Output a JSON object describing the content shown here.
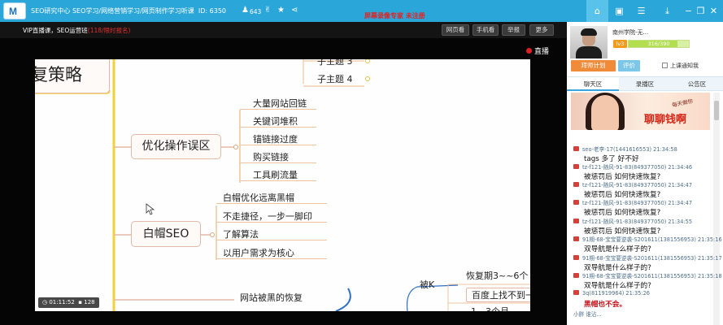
{
  "titlebar": {
    "logo": "M",
    "title": "SEO研究中心 SEO学习/网络营销学习/网页制作学习听课",
    "id_label": "ID: 6350",
    "listeners": "643",
    "register_text": "屏幕录像专家  未注册",
    "icons": [
      "user-icon",
      "thumbs-up-icon",
      "star-icon",
      "share-icon"
    ],
    "window_buttons": [
      "home-icon",
      "skin-icon",
      "menu-icon",
      "download-icon",
      "minimize-icon",
      "restore-icon",
      "close-icon"
    ]
  },
  "video_header": {
    "course": "VIP直播课，SEO运营班",
    "course_highlight": "(118/限时报名)",
    "buttons": [
      "网页看",
      "手机看",
      "举报",
      "更多"
    ]
  },
  "live_label": "直播",
  "mindmap": {
    "title": "复策略",
    "top_items": [
      "子主题 3",
      "子主题 4"
    ],
    "branches": [
      {
        "name": "优化操作误区",
        "items": [
          "大量网站回链",
          "关键词堆积",
          "锚链接过度",
          "购买链接",
          "工具刷流量"
        ]
      },
      {
        "name": "白帽SEO",
        "items": [
          "白帽优化远离黑帽",
          "不走捷径，一步一脚印",
          "了解算法",
          "以用户需求为核心"
        ]
      }
    ],
    "bottom": {
      "recovery": "网站被黑的恢复",
      "punished": "被K",
      "items": [
        "恢复期3~~6个",
        "百度上找不到一",
        "1，3个月"
      ]
    }
  },
  "video_status": {
    "time": "01:11:52",
    "count": "128"
  },
  "profile": {
    "username": "南州学院-无... ",
    "level": "lv3",
    "progress_text": "316/390",
    "progress_fraction": 0.81,
    "plan_button": "拜师计划",
    "eval_button": "评价",
    "notify_label": "上课通知我"
  },
  "tabs": [
    "聊天区",
    "录播区",
    "公告区"
  ],
  "banner": {
    "slogan": "聊聊钱啊",
    "tag": "每天做你"
  },
  "chat": [
    {
      "meta": "seo-老李-17(1441616553) 21:34:58",
      "text": "tags  多了   好不好",
      "red": false
    },
    {
      "meta": "tz-f121-随风-91-83(849377050) 21:34:46",
      "text": "被惩罚后 如何快速恢复?",
      "red": false
    },
    {
      "meta": "tz-f121-随风-91-83(849377050) 21:34:47",
      "text": "被惩罚后 如何快速恢复?",
      "red": false
    },
    {
      "meta": "tz-f121-随风-91-83(849377050) 21:34:47",
      "text": "被惩罚后 如何快速恢复?",
      "red": false
    },
    {
      "meta": "tz-f121-随风-91-83(849377050) 21:34:55",
      "text": "被惩罚后 如何快速恢复?",
      "red": false
    },
    {
      "meta": "91期-68-宝宝要逆袭-S201611(1381556953) 21:35:16",
      "text": "双导航是什么样子的?",
      "red": false
    },
    {
      "meta": "91期-68-宝宝要逆袭-S201611(1381556953) 21:35:17",
      "text": "双导航是什么样子的?",
      "red": false
    },
    {
      "meta": "91期-68-宝宝要逆袭-S201611(1381556953) 21:35:18",
      "text": "双导航是什么样子的?",
      "red": false
    },
    {
      "meta": "3q(811919964) 21:35:26",
      "text": "黑帽也不会。",
      "red": true
    }
  ],
  "chat_cutoff": "小胖  谁沾..."
}
